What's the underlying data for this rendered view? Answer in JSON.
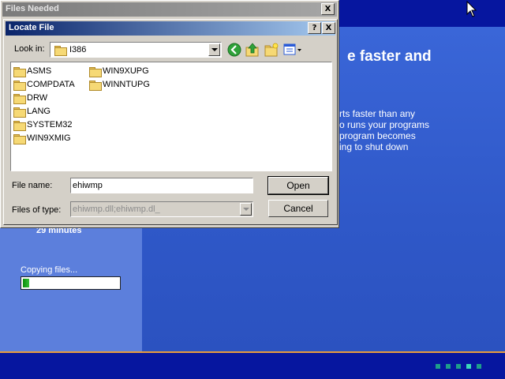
{
  "setup_background": {
    "headline_fragment": "e faster and",
    "body_lines": [
      "rts faster than any",
      "o runs your programs",
      "program becomes",
      "ing to shut down"
    ],
    "time_remaining": "29 minutes",
    "status_text": "Copying files...",
    "progress_percent": 5,
    "step_dots": 5,
    "active_step": 4
  },
  "files_needed_window": {
    "title": "Files Needed"
  },
  "locate_file_dialog": {
    "title": "Locate File",
    "help_button": "?",
    "close_button": "X",
    "look_in_label": "Look in:",
    "look_in_value": "I386",
    "toolbar_icons": [
      "back-icon",
      "up-folder-icon",
      "new-folder-icon",
      "view-menu-icon"
    ],
    "folders_col1": [
      "ASMS",
      "COMPDATA",
      "DRW",
      "LANG",
      "SYSTEM32",
      "WIN9XMIG"
    ],
    "folders_col2": [
      "WIN9XUPG",
      "WINNTUPG"
    ],
    "file_name_label": "File name:",
    "file_name_value": "ehiwmp",
    "files_of_type_label": "Files of type:",
    "files_of_type_value": "ehiwmp.dll;ehiwmp.dl_",
    "open_button": "Open",
    "cancel_button": "Cancel"
  },
  "colors": {
    "title_active": "#0a246a",
    "title_inactive": "#7b7b7b",
    "dialog_face": "#d4d0c8",
    "progress_fill": "#1ea51e",
    "setup_blue": "#2f57c4"
  }
}
